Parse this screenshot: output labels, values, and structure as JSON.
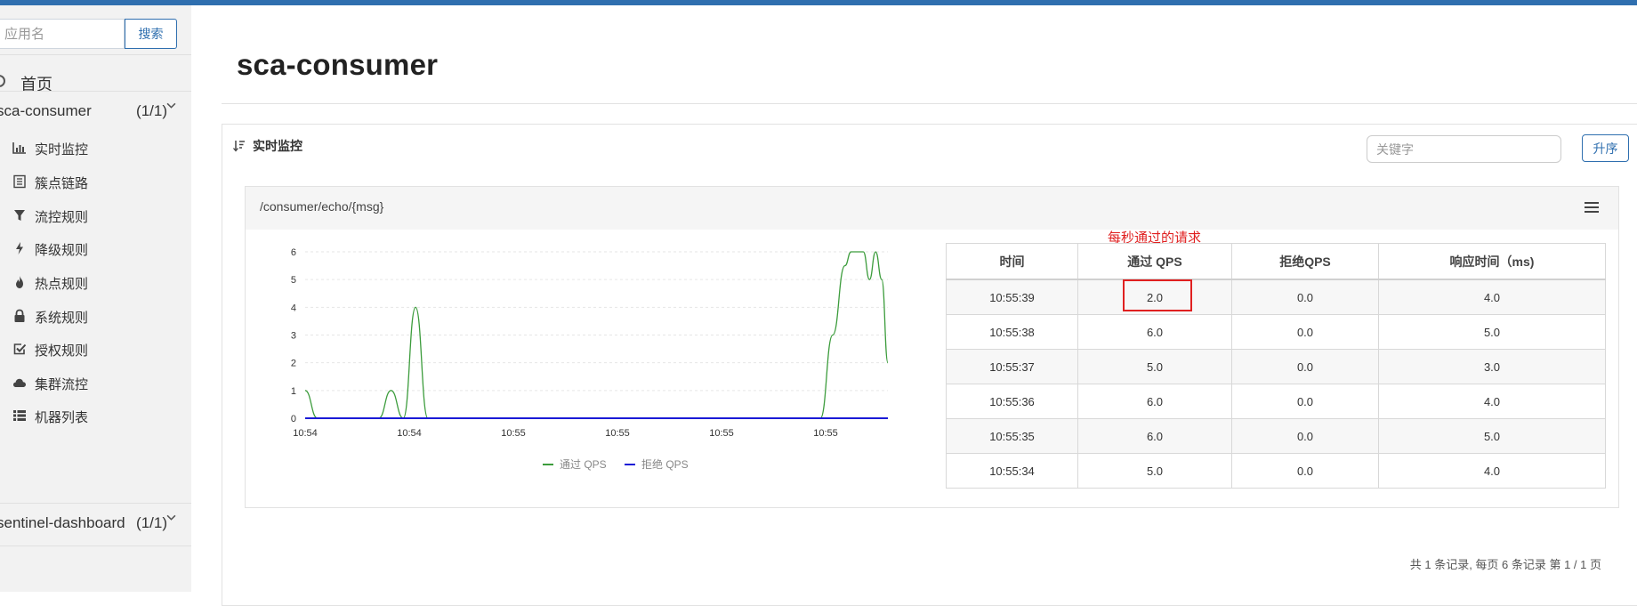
{
  "sidebar": {
    "search_placeholder": "应用名",
    "search_button": "搜索",
    "home_label": "首页",
    "apps": [
      {
        "name": "sca-consumer",
        "count": "(1/1)"
      },
      {
        "name": "sentinel-dashboard",
        "count": "(1/1)"
      }
    ],
    "menu": [
      {
        "label": "实时监控",
        "icon": "bar-chart-icon"
      },
      {
        "label": "簇点链路",
        "icon": "list-icon"
      },
      {
        "label": "流控规则",
        "icon": "filter-icon"
      },
      {
        "label": "降级规则",
        "icon": "flash-icon"
      },
      {
        "label": "热点规则",
        "icon": "fire-icon"
      },
      {
        "label": "系统规则",
        "icon": "lock-icon"
      },
      {
        "label": "授权规则",
        "icon": "check-icon"
      },
      {
        "label": "集群流控",
        "icon": "cloud-icon"
      },
      {
        "label": "机器列表",
        "icon": "th-list-icon"
      }
    ]
  },
  "header": {
    "title": "sca-consumer"
  },
  "panel": {
    "title": "实时监控",
    "keyword_placeholder": "关键字",
    "sort_button": "升序"
  },
  "card": {
    "resource": "/consumer/echo/{msg}",
    "annotation": "每秒通过的请求",
    "table": {
      "headers": [
        "时间",
        "通过 QPS",
        "拒绝QPS",
        "响应时间（ms)"
      ],
      "rows": [
        [
          "10:55:39",
          "2.0",
          "0.0",
          "4.0"
        ],
        [
          "10:55:38",
          "6.0",
          "0.0",
          "5.0"
        ],
        [
          "10:55:37",
          "5.0",
          "0.0",
          "3.0"
        ],
        [
          "10:55:36",
          "6.0",
          "0.0",
          "4.0"
        ],
        [
          "10:55:35",
          "6.0",
          "0.0",
          "5.0"
        ],
        [
          "10:55:34",
          "5.0",
          "0.0",
          "4.0"
        ]
      ]
    }
  },
  "footer": {
    "pagination": "共 1 条记录, 每页 6 条记录 第 1 / 1 页"
  },
  "colors": {
    "accent": "#2f6faf",
    "pass_series": "#3c9c3c",
    "block_series": "#1a1ad6",
    "annotation": "#e02020"
  },
  "chart_data": {
    "type": "line",
    "x_tick_labels": [
      "10:54",
      "10:54",
      "10:55",
      "10:55",
      "10:55",
      "10:55"
    ],
    "y_ticks": [
      0,
      1,
      2,
      3,
      4,
      5,
      6
    ],
    "ylim": [
      0,
      6
    ],
    "grid": true,
    "legend_position": "bottom",
    "series": [
      {
        "name": "通过 QPS",
        "color": "#3c9c3c",
        "points": [
          [
            0,
            1
          ],
          [
            2,
            0
          ],
          [
            6,
            0
          ],
          [
            10,
            0
          ],
          [
            12,
            0
          ],
          [
            14,
            1
          ],
          [
            16,
            0
          ],
          [
            18,
            4
          ],
          [
            20,
            0
          ],
          [
            24,
            0
          ],
          [
            30,
            0
          ],
          [
            40,
            0
          ],
          [
            50,
            0
          ],
          [
            60,
            0
          ],
          [
            70,
            0
          ],
          [
            80,
            0
          ],
          [
            84,
            0
          ],
          [
            86,
            3
          ],
          [
            88,
            5.5
          ],
          [
            89,
            6
          ],
          [
            91,
            6
          ],
          [
            92,
            5
          ],
          [
            93,
            6
          ],
          [
            94,
            5
          ],
          [
            95,
            2
          ]
        ]
      },
      {
        "name": "拒绝 QPS",
        "color": "#1a1ad6",
        "points": [
          [
            0,
            0
          ],
          [
            95,
            0
          ]
        ]
      }
    ]
  }
}
